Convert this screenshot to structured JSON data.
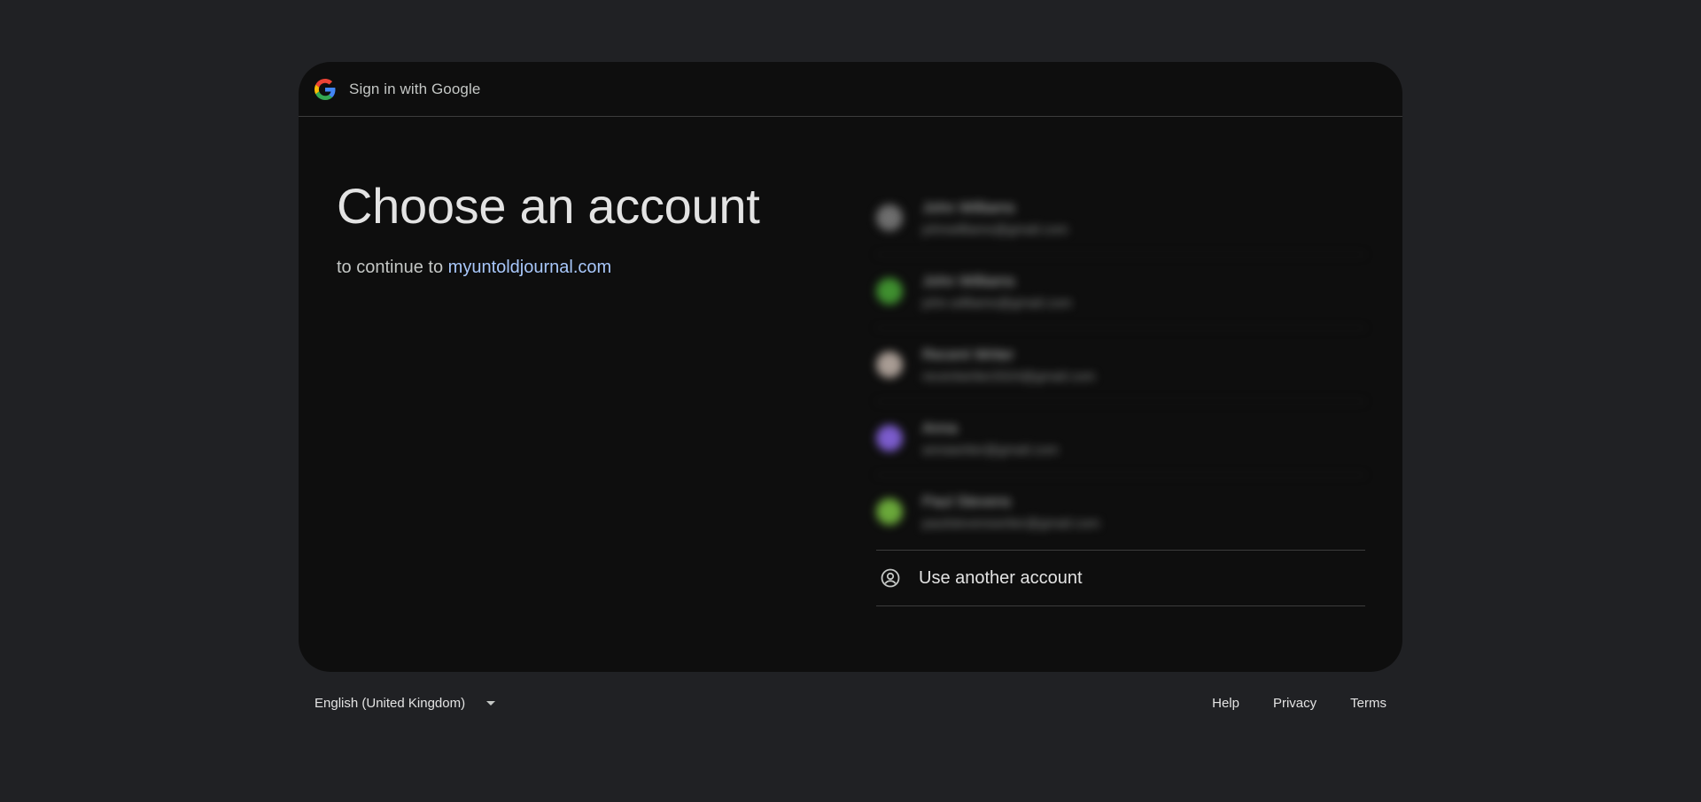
{
  "header": {
    "title": "Sign in with Google"
  },
  "main": {
    "heading": "Choose an account",
    "subtitle_prefix": "to continue to",
    "site_link": "myuntoldjournal.com"
  },
  "accounts": [
    {
      "name": "John Williams",
      "email": "johnwilliams@gmail.com",
      "avatar_color": "#6e6e6e"
    },
    {
      "name": "John Williams",
      "email": "john.williams@gmail.com",
      "avatar_color": "#3f8f2f"
    },
    {
      "name": "Recent Writer",
      "email": "recentwriter2024@gmail.com",
      "avatar_color": "#a89c94"
    },
    {
      "name": "Anna",
      "email": "annawriter@gmail.com",
      "avatar_color": "#7b5ccc"
    },
    {
      "name": "Paul Stevens",
      "email": "paulstevenswriter@gmail.com",
      "avatar_color": "#6aa83a"
    }
  ],
  "use_another": {
    "label": "Use another account",
    "icon": "account-circle-icon"
  },
  "footer": {
    "language": "English (United Kingdom)",
    "help": "Help",
    "privacy": "Privacy",
    "terms": "Terms"
  },
  "colors": {
    "background": "#202124",
    "card": "#0e0e0e",
    "link": "#a8c7fa"
  }
}
